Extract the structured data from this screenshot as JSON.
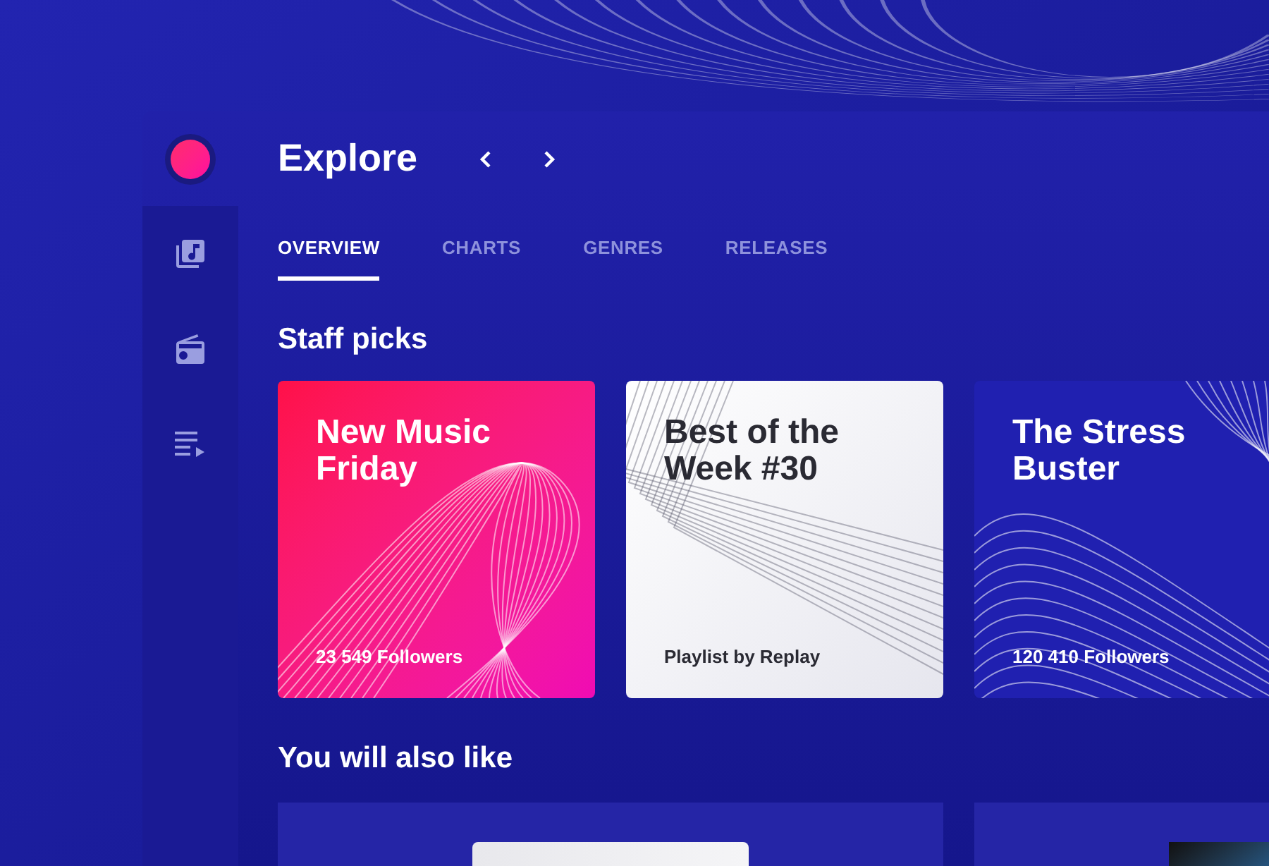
{
  "header": {
    "title": "Explore"
  },
  "tabs": [
    {
      "label": "OVERVIEW",
      "selected": true
    },
    {
      "label": "CHARTS",
      "selected": false
    },
    {
      "label": "GENRES",
      "selected": false
    },
    {
      "label": "RELEASES",
      "selected": false
    }
  ],
  "staff_picks": {
    "title": "Staff picks",
    "cards": [
      {
        "kind": "pink",
        "title": "New Music Friday",
        "subtitle": "23 549 Followers"
      },
      {
        "kind": "white",
        "title": "Best of the Week #30",
        "subtitle": "Playlist by Replay"
      },
      {
        "kind": "blue",
        "title": "The Stress Buster",
        "subtitle": "120 410 Followers"
      }
    ]
  },
  "recommendations": {
    "title": "You will also like"
  }
}
